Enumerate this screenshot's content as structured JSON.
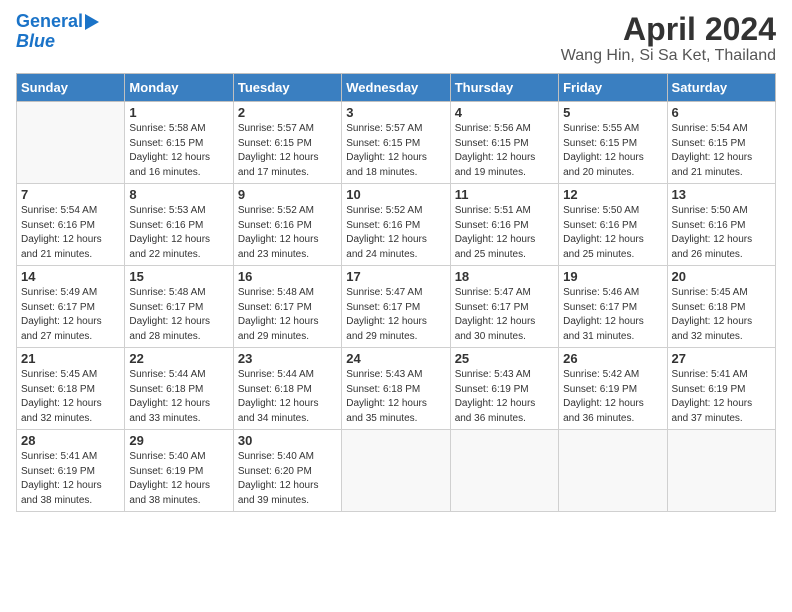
{
  "header": {
    "logo_line1": "General",
    "logo_line2": "Blue",
    "title": "April 2024",
    "subtitle": "Wang Hin, Si Sa Ket, Thailand"
  },
  "days_of_week": [
    "Sunday",
    "Monday",
    "Tuesday",
    "Wednesday",
    "Thursday",
    "Friday",
    "Saturday"
  ],
  "weeks": [
    [
      {
        "day": null,
        "sunrise": null,
        "sunset": null,
        "daylight": null
      },
      {
        "day": "1",
        "sunrise": "5:58 AM",
        "sunset": "6:15 PM",
        "daylight": "12 hours and 16 minutes."
      },
      {
        "day": "2",
        "sunrise": "5:57 AM",
        "sunset": "6:15 PM",
        "daylight": "12 hours and 17 minutes."
      },
      {
        "day": "3",
        "sunrise": "5:57 AM",
        "sunset": "6:15 PM",
        "daylight": "12 hours and 18 minutes."
      },
      {
        "day": "4",
        "sunrise": "5:56 AM",
        "sunset": "6:15 PM",
        "daylight": "12 hours and 19 minutes."
      },
      {
        "day": "5",
        "sunrise": "5:55 AM",
        "sunset": "6:15 PM",
        "daylight": "12 hours and 20 minutes."
      },
      {
        "day": "6",
        "sunrise": "5:54 AM",
        "sunset": "6:15 PM",
        "daylight": "12 hours and 21 minutes."
      }
    ],
    [
      {
        "day": "7",
        "sunrise": "5:54 AM",
        "sunset": "6:16 PM",
        "daylight": "12 hours and 21 minutes."
      },
      {
        "day": "8",
        "sunrise": "5:53 AM",
        "sunset": "6:16 PM",
        "daylight": "12 hours and 22 minutes."
      },
      {
        "day": "9",
        "sunrise": "5:52 AM",
        "sunset": "6:16 PM",
        "daylight": "12 hours and 23 minutes."
      },
      {
        "day": "10",
        "sunrise": "5:52 AM",
        "sunset": "6:16 PM",
        "daylight": "12 hours and 24 minutes."
      },
      {
        "day": "11",
        "sunrise": "5:51 AM",
        "sunset": "6:16 PM",
        "daylight": "12 hours and 25 minutes."
      },
      {
        "day": "12",
        "sunrise": "5:50 AM",
        "sunset": "6:16 PM",
        "daylight": "12 hours and 25 minutes."
      },
      {
        "day": "13",
        "sunrise": "5:50 AM",
        "sunset": "6:16 PM",
        "daylight": "12 hours and 26 minutes."
      }
    ],
    [
      {
        "day": "14",
        "sunrise": "5:49 AM",
        "sunset": "6:17 PM",
        "daylight": "12 hours and 27 minutes."
      },
      {
        "day": "15",
        "sunrise": "5:48 AM",
        "sunset": "6:17 PM",
        "daylight": "12 hours and 28 minutes."
      },
      {
        "day": "16",
        "sunrise": "5:48 AM",
        "sunset": "6:17 PM",
        "daylight": "12 hours and 29 minutes."
      },
      {
        "day": "17",
        "sunrise": "5:47 AM",
        "sunset": "6:17 PM",
        "daylight": "12 hours and 29 minutes."
      },
      {
        "day": "18",
        "sunrise": "5:47 AM",
        "sunset": "6:17 PM",
        "daylight": "12 hours and 30 minutes."
      },
      {
        "day": "19",
        "sunrise": "5:46 AM",
        "sunset": "6:17 PM",
        "daylight": "12 hours and 31 minutes."
      },
      {
        "day": "20",
        "sunrise": "5:45 AM",
        "sunset": "6:18 PM",
        "daylight": "12 hours and 32 minutes."
      }
    ],
    [
      {
        "day": "21",
        "sunrise": "5:45 AM",
        "sunset": "6:18 PM",
        "daylight": "12 hours and 32 minutes."
      },
      {
        "day": "22",
        "sunrise": "5:44 AM",
        "sunset": "6:18 PM",
        "daylight": "12 hours and 33 minutes."
      },
      {
        "day": "23",
        "sunrise": "5:44 AM",
        "sunset": "6:18 PM",
        "daylight": "12 hours and 34 minutes."
      },
      {
        "day": "24",
        "sunrise": "5:43 AM",
        "sunset": "6:18 PM",
        "daylight": "12 hours and 35 minutes."
      },
      {
        "day": "25",
        "sunrise": "5:43 AM",
        "sunset": "6:19 PM",
        "daylight": "12 hours and 36 minutes."
      },
      {
        "day": "26",
        "sunrise": "5:42 AM",
        "sunset": "6:19 PM",
        "daylight": "12 hours and 36 minutes."
      },
      {
        "day": "27",
        "sunrise": "5:41 AM",
        "sunset": "6:19 PM",
        "daylight": "12 hours and 37 minutes."
      }
    ],
    [
      {
        "day": "28",
        "sunrise": "5:41 AM",
        "sunset": "6:19 PM",
        "daylight": "12 hours and 38 minutes."
      },
      {
        "day": "29",
        "sunrise": "5:40 AM",
        "sunset": "6:19 PM",
        "daylight": "12 hours and 38 minutes."
      },
      {
        "day": "30",
        "sunrise": "5:40 AM",
        "sunset": "6:20 PM",
        "daylight": "12 hours and 39 minutes."
      },
      {
        "day": null,
        "sunrise": null,
        "sunset": null,
        "daylight": null
      },
      {
        "day": null,
        "sunrise": null,
        "sunset": null,
        "daylight": null
      },
      {
        "day": null,
        "sunrise": null,
        "sunset": null,
        "daylight": null
      },
      {
        "day": null,
        "sunrise": null,
        "sunset": null,
        "daylight": null
      }
    ]
  ],
  "labels": {
    "sunrise": "Sunrise:",
    "sunset": "Sunset:",
    "daylight": "Daylight:"
  }
}
